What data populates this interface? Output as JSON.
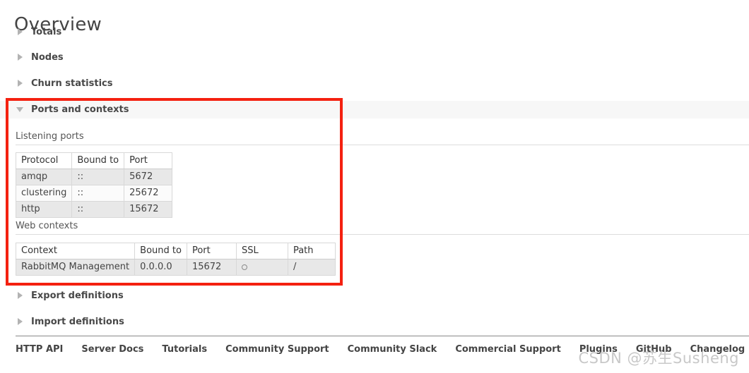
{
  "page": {
    "title": "Overview"
  },
  "sections": [
    {
      "label": "Totals",
      "state": "collapsed",
      "icon": "triangle-right-icon"
    },
    {
      "label": "Nodes",
      "state": "collapsed",
      "icon": "triangle-right-icon"
    },
    {
      "label": "Churn statistics",
      "state": "collapsed",
      "icon": "triangle-right-icon"
    },
    {
      "label": "Ports and contexts",
      "state": "expanded",
      "icon": "triangle-down-icon"
    },
    {
      "label": "Export definitions",
      "state": "collapsed",
      "icon": "triangle-right-icon"
    },
    {
      "label": "Import definitions",
      "state": "collapsed",
      "icon": "triangle-right-icon"
    }
  ],
  "ports_and_contexts": {
    "listening_ports": {
      "label": "Listening ports",
      "columns": [
        "Protocol",
        "Bound to",
        "Port"
      ],
      "rows": [
        [
          "amqp",
          "::",
          "5672"
        ],
        [
          "clustering",
          "::",
          "25672"
        ],
        [
          "http",
          "::",
          "15672"
        ]
      ]
    },
    "web_contexts": {
      "label": "Web contexts",
      "columns": [
        "Context",
        "Bound to",
        "Port",
        "SSL",
        "Path"
      ],
      "rows": [
        {
          "context": "RabbitMQ Management",
          "bound_to": "0.0.0.0",
          "port": "15672",
          "ssl": "circle-icon",
          "path": "/"
        }
      ]
    }
  },
  "highlight": {
    "color": "#f42110",
    "target": "ports-and-contexts"
  },
  "footer": {
    "links": [
      "HTTP API",
      "Server Docs",
      "Tutorials",
      "Community Support",
      "Community Slack",
      "Commercial Support",
      "Plugins",
      "GitHub",
      "Changelog"
    ]
  },
  "watermark": {
    "text": "CSDN @苏生Susheng"
  }
}
